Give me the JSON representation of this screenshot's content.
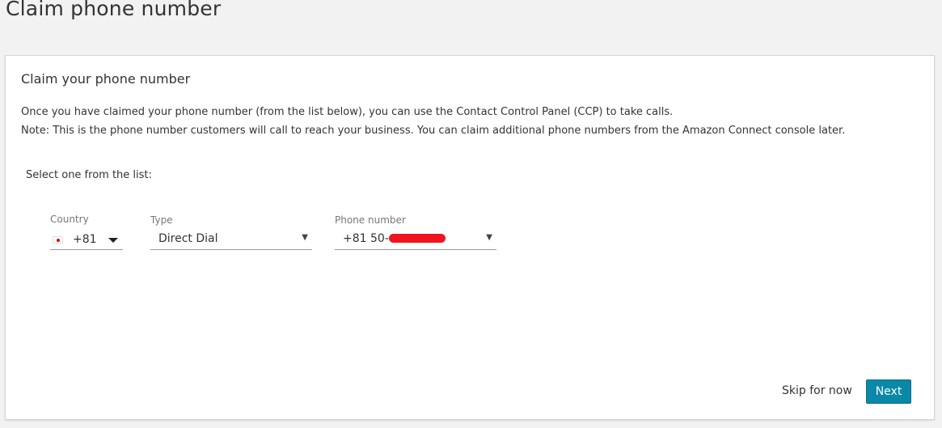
{
  "page": {
    "title": "Claim phone number"
  },
  "card": {
    "title": "Claim your phone number",
    "description_line1": "Once you have claimed your phone number (from the list below), you can use the Contact Control Panel (CCP) to take calls.",
    "description_line2": "Note: This is the phone number customers will call to reach your business. You can claim additional phone numbers from the Amazon Connect console later.",
    "select_prompt": "Select one from the list:"
  },
  "form": {
    "country": {
      "label": "Country",
      "value": "+81",
      "flag_icon": "japan-flag-icon"
    },
    "type": {
      "label": "Type",
      "value": "Direct Dial"
    },
    "phone_number": {
      "label": "Phone number",
      "value_prefix": "+81 50-"
    }
  },
  "actions": {
    "skip_label": "Skip for now",
    "next_label": "Next"
  },
  "colors": {
    "primary_button": "#0a88a7",
    "redaction": "#f0141e",
    "background": "#f2f2f2"
  }
}
